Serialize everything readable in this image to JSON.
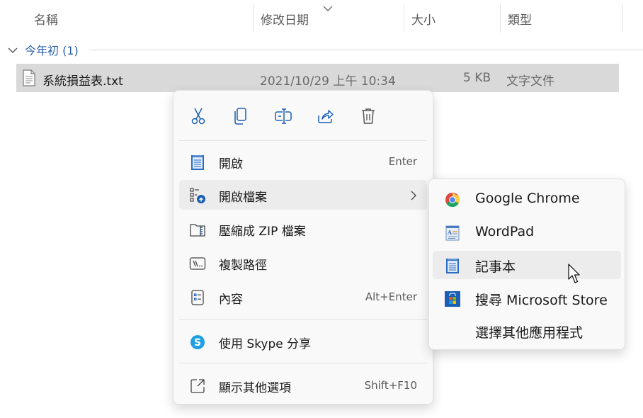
{
  "columns": {
    "name": "名稱",
    "date_modified": "修改日期",
    "size": "大小",
    "type": "類型"
  },
  "group": {
    "label": "今年初 (1)"
  },
  "file": {
    "name": "系統損益表.txt",
    "date_modified": "2021/10/29 上午 10:34",
    "size": "5 KB",
    "type": "文字文件"
  },
  "context_menu": {
    "quick_actions": [
      {
        "action": "cut",
        "icon": "scissors-icon"
      },
      {
        "action": "copy",
        "icon": "copy-icon"
      },
      {
        "action": "rename",
        "icon": "rename-icon"
      },
      {
        "action": "share",
        "icon": "share-icon"
      },
      {
        "action": "delete",
        "icon": "trash-icon"
      }
    ],
    "items": [
      {
        "label": "開啟",
        "shortcut": "Enter",
        "icon": "notepad-icon"
      },
      {
        "label": "開啟檔案",
        "shortcut": "",
        "icon": "open-with-icon",
        "has_submenu": true
      },
      {
        "label": "壓縮成 ZIP 檔案",
        "shortcut": "",
        "icon": "zip-folder-icon"
      },
      {
        "label": "複製路徑",
        "shortcut": "",
        "icon": "copy-path-icon"
      },
      {
        "label": "內容",
        "shortcut": "Alt+Enter",
        "icon": "properties-icon"
      },
      {
        "label": "使用 Skype 分享",
        "shortcut": "",
        "icon": "skype-icon"
      },
      {
        "label": "顯示其他選項",
        "shortcut": "Shift+F10",
        "icon": "more-options-icon"
      }
    ]
  },
  "submenu": {
    "items": [
      {
        "label": "Google Chrome",
        "icon": "chrome-icon"
      },
      {
        "label": "WordPad",
        "icon": "wordpad-icon"
      },
      {
        "label": "記事本",
        "icon": "notepad-icon"
      },
      {
        "label": "搜尋 Microsoft Store",
        "icon": "store-icon"
      },
      {
        "label": "選擇其他應用程式",
        "icon": ""
      }
    ]
  },
  "colors": {
    "accent": "#2a5fa8",
    "row_selected": "#d9d9d9",
    "menu_bg": "#f9f9f9",
    "hover": "#ececec"
  }
}
